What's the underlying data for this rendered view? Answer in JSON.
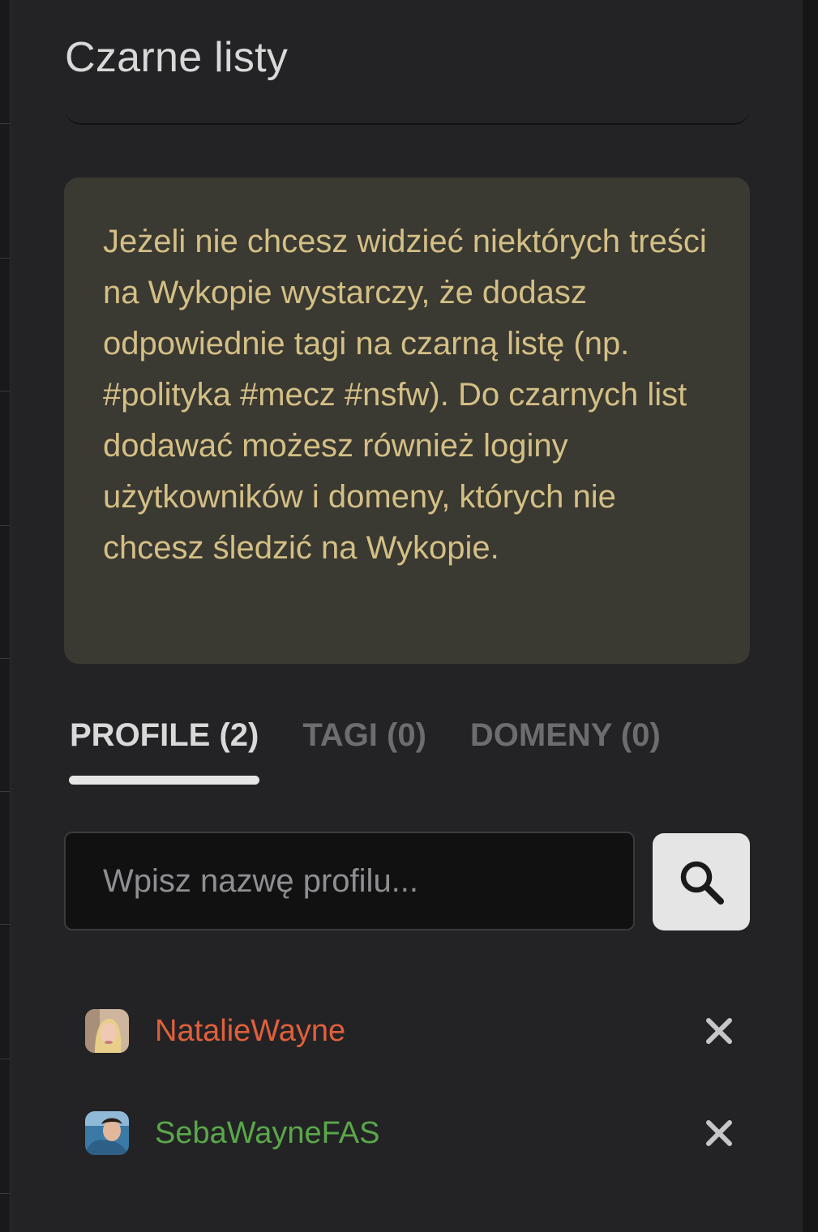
{
  "page": {
    "title": "Czarne listy"
  },
  "notice": {
    "text": "Jeżeli nie chcesz widzieć niektórych treści na Wykopie wystarczy, że dodasz odpowiednie tagi na czarną listę (np. #polityka #mecz #nsfw). Do czarnych list dodawać możesz również loginy użytkowników i domeny, których nie chcesz śledzić na Wykopie."
  },
  "tabs": [
    {
      "label": "PROFILE (2)",
      "active": true
    },
    {
      "label": "TAGI (0)",
      "active": false
    },
    {
      "label": "DOMENY (0)",
      "active": false
    }
  ],
  "search": {
    "placeholder": "Wpisz nazwę profilu...",
    "value": ""
  },
  "profiles": [
    {
      "name": "NatalieWayne",
      "color": "#e0603a"
    },
    {
      "name": "SebaWayneFAS",
      "color": "#5aa74a"
    }
  ],
  "icons": {
    "search": "search-icon",
    "remove": "close-icon"
  },
  "colors": {
    "notice_background": "#3a3932",
    "notice_text": "#d4bf85",
    "panel_background": "#232325"
  }
}
